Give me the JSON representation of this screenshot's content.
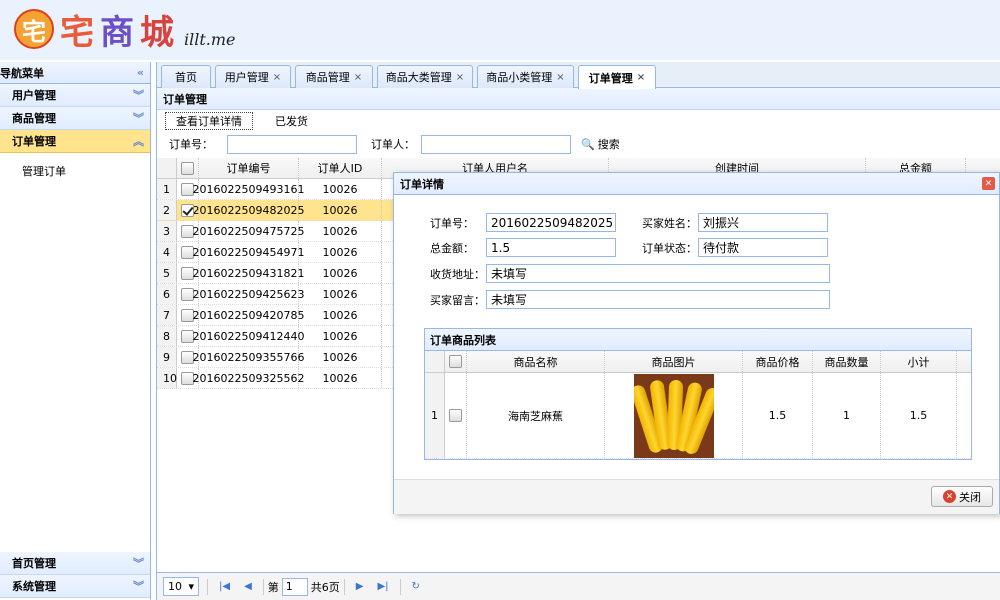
{
  "banner": {
    "logo_mark": "宅",
    "logo_text": [
      "宅",
      "商",
      "城"
    ],
    "logo_domain": "illt.me"
  },
  "nav": {
    "title": "导航菜单",
    "collapse_icon": "«",
    "sections": [
      {
        "label": "用户管理",
        "expanded": false
      },
      {
        "label": "商品管理",
        "expanded": false
      },
      {
        "label": "订单管理",
        "expanded": true,
        "items": [
          "管理订单"
        ]
      }
    ],
    "bottom_sections": [
      {
        "label": "首页管理"
      },
      {
        "label": "系统管理"
      }
    ]
  },
  "tabs": [
    {
      "label": "首页",
      "closable": false
    },
    {
      "label": "用户管理",
      "closable": true
    },
    {
      "label": "商品管理",
      "closable": true
    },
    {
      "label": "商品大类管理",
      "closable": true
    },
    {
      "label": "商品小类管理",
      "closable": true
    },
    {
      "label": "订单管理",
      "closable": true,
      "selected": true
    }
  ],
  "panel": {
    "title": "订单管理",
    "toolbar": {
      "view_detail": "查看订单详情",
      "shipped": "已发货"
    },
    "search": {
      "order_no_label": "订单号：",
      "order_no_value": "",
      "orderer_label": "订单人：",
      "orderer_value": "",
      "search_label": "搜索"
    }
  },
  "grid": {
    "headers": [
      "订单编号",
      "订单人ID",
      "订单人用户名",
      "创建时间",
      "总金额"
    ],
    "rows": [
      {
        "n": "1",
        "id": "2016022509493161",
        "uid": "10026",
        "checked": false
      },
      {
        "n": "2",
        "id": "2016022509482025",
        "uid": "10026",
        "checked": true
      },
      {
        "n": "3",
        "id": "2016022509475725",
        "uid": "10026",
        "checked": false
      },
      {
        "n": "4",
        "id": "2016022509454971",
        "uid": "10026",
        "checked": false
      },
      {
        "n": "5",
        "id": "2016022509431821",
        "uid": "10026",
        "checked": false
      },
      {
        "n": "6",
        "id": "2016022509425623",
        "uid": "10026",
        "checked": false
      },
      {
        "n": "7",
        "id": "2016022509420785",
        "uid": "10026",
        "checked": false
      },
      {
        "n": "8",
        "id": "2016022509412440",
        "uid": "10026",
        "checked": false
      },
      {
        "n": "9",
        "id": "2016022509355766",
        "uid": "10026",
        "checked": false
      },
      {
        "n": "10",
        "id": "2016022509325562",
        "uid": "10026",
        "checked": false
      }
    ]
  },
  "pager": {
    "page_size": "10",
    "page_label": "第",
    "page": "1",
    "total_label": "共6页"
  },
  "dialog": {
    "title": "订单详情",
    "order_no_label": "订单号：",
    "order_no": "2016022509482025",
    "buyer_label": "买家姓名：",
    "buyer": "刘振兴",
    "total_label": "总金额：",
    "total": "1.5",
    "status_label": "订单状态：",
    "status": "待付款",
    "address_label": "收货地址：",
    "address": "未填写",
    "message_label": "买家留言：",
    "message": "未填写",
    "items_title": "订单商品列表",
    "items_headers": [
      "商品名称",
      "商品图片",
      "商品价格",
      "商品数量",
      "小计"
    ],
    "items": [
      {
        "n": "1",
        "name": "海南芝麻蕉",
        "price": "1.5",
        "qty": "1",
        "subtotal": "1.5"
      }
    ],
    "close_label": "关闭"
  }
}
